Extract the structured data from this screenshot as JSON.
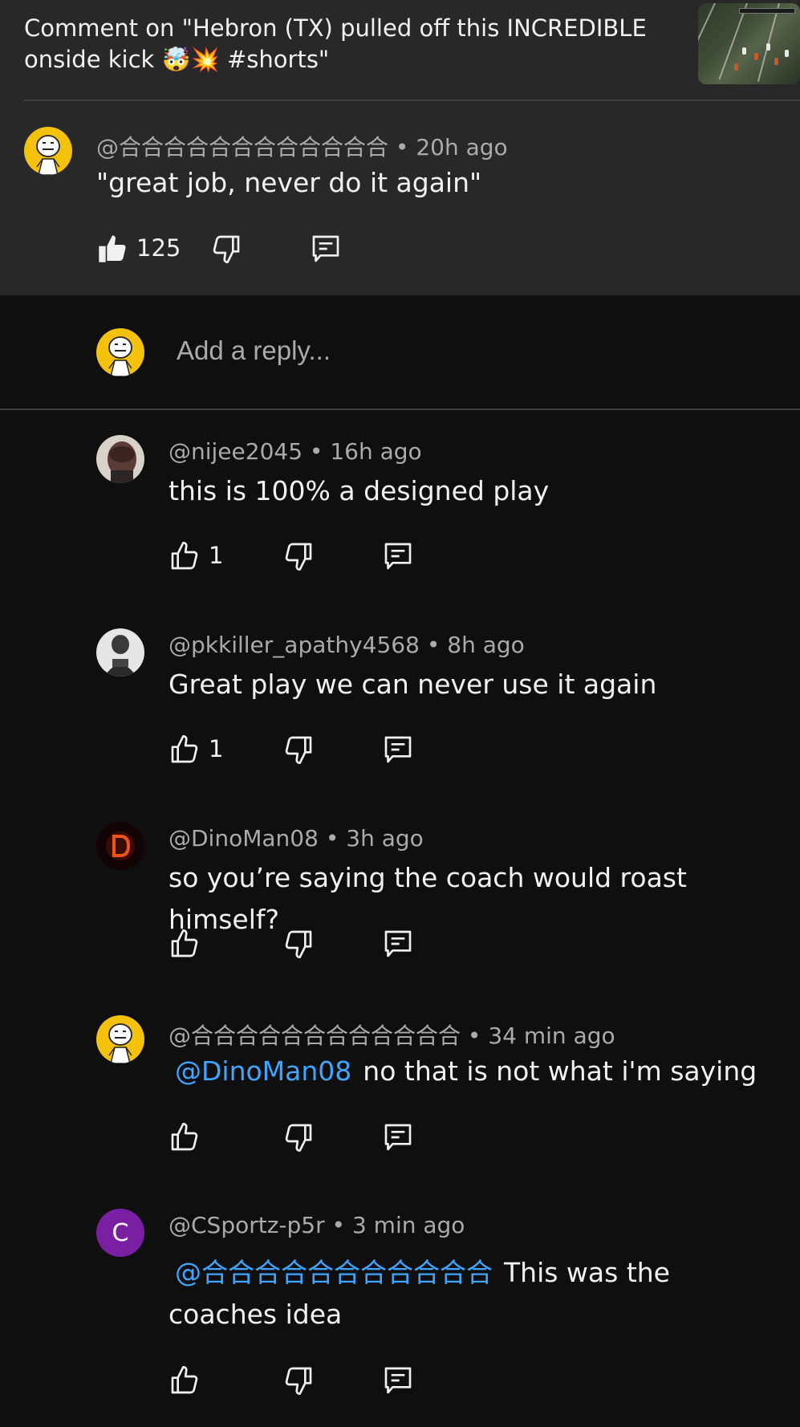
{
  "header": {
    "title": "Comment on \"Hebron (TX) pulled off this INCREDIBLE onside kick 🤯💥 #shorts\"",
    "thumbnail_icon": "video-thumbnail"
  },
  "parent_comment": {
    "author": "@合合合合合合合合合合合合",
    "time": "20h ago",
    "text": "\"great job, never do it again\"",
    "likes": "125"
  },
  "reply_box": {
    "placeholder": "Add a reply..."
  },
  "replies": [
    {
      "author": "@nijee2045",
      "time": "16h ago",
      "text": "this is 100% a designed play",
      "likes": "1"
    },
    {
      "author": "@pkkiller_apathy4568",
      "time": "8h ago",
      "text": "Great play we can never use it again",
      "likes": "1"
    },
    {
      "author": "@DinoMan08",
      "time": "3h ago",
      "text": "so you’re saying the coach would roast himself?",
      "likes": ""
    },
    {
      "author": "@合合合合合合合合合合合合",
      "time": "34 min ago",
      "mention": "@DinoMan08",
      "text": "no that is not what i'm saying",
      "likes": ""
    },
    {
      "author": "@CSportz-p5r",
      "time": "3 min ago",
      "avatar_letter": "C",
      "mention": "@合合合合合合合合合合合",
      "text": "This was the coaches idea",
      "likes": ""
    }
  ],
  "separator": " • ",
  "colors": {
    "background": "#0f0f0f",
    "highlight_background": "#282828",
    "mention": "#3ea6ff",
    "avatar_c": "#7b1fa2",
    "avatar_yellow": "#f4c20d"
  }
}
